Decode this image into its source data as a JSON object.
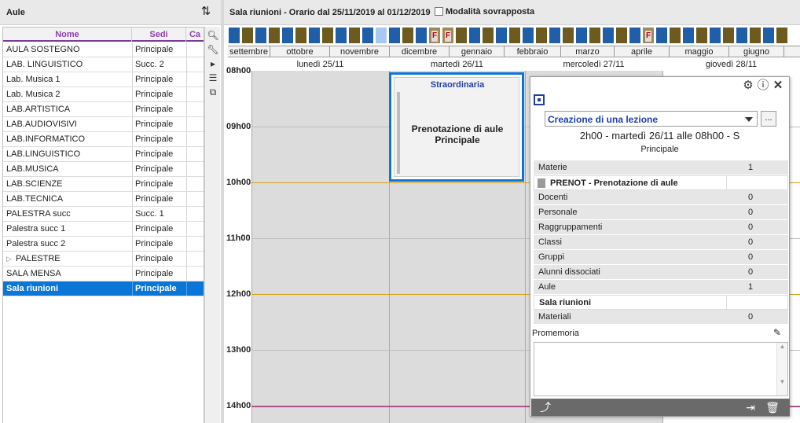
{
  "left": {
    "title": "Aule",
    "columns": [
      "Nome",
      "Sedi",
      "Ca"
    ],
    "rows": [
      {
        "name": "AULA SOSTEGNO",
        "sede": "Principale"
      },
      {
        "name": "LAB. LINGUISTICO",
        "sede": "Succ. 2"
      },
      {
        "name": "Lab. Musica 1",
        "sede": "Principale"
      },
      {
        "name": "Lab. Musica 2",
        "sede": "Principale"
      },
      {
        "name": "LAB.ARTISTICA",
        "sede": "Principale"
      },
      {
        "name": "LAB.AUDIOVISIVI",
        "sede": "Principale"
      },
      {
        "name": "LAB.INFORMATICO",
        "sede": "Principale"
      },
      {
        "name": "LAB.LINGUISTICO",
        "sede": "Principale"
      },
      {
        "name": "LAB.MUSICA",
        "sede": "Principale"
      },
      {
        "name": "LAB.SCIENZE",
        "sede": "Principale"
      },
      {
        "name": "LAB.TECNICA",
        "sede": "Principale"
      },
      {
        "name": "PALESTRA succ",
        "sede": "Succ. 1"
      },
      {
        "name": "Palestra succ 1",
        "sede": "Principale"
      },
      {
        "name": "Palestra succ 2",
        "sede": "Principale"
      },
      {
        "name": "PALESTRE",
        "sede": "Principale"
      },
      {
        "name": "SALA MENSA",
        "sede": "Principale"
      },
      {
        "name": "Sala riunioni",
        "sede": "Principale"
      }
    ]
  },
  "right": {
    "title": "Sala riunioni - Orario dal 25/11/2019 al 01/12/2019",
    "mode_label": "Modalità sovrapposta",
    "months": [
      "settembre",
      "ottobre",
      "novembre",
      "dicembre",
      "gennaio",
      "febbraio",
      "marzo",
      "aprile",
      "maggio",
      "giugno"
    ],
    "days": [
      "lunedì 25/11",
      "martedì 26/11",
      "mercoledì 27/11",
      "giovedì 28/11"
    ],
    "hours": [
      "08h00",
      "09h00",
      "10h00",
      "11h00",
      "12h00",
      "13h00",
      "14h00"
    ],
    "holiday_mark": "F"
  },
  "lesson": {
    "title": "Straordinaria",
    "text": "Prenotazione di aule Principale"
  },
  "popup": {
    "select_value": "Creazione di una lezione",
    "more": "...",
    "duration": "2h00  -  martedì 26/11 alle 08h00  -  S",
    "sede": "Principale",
    "rows": [
      {
        "label": "Materie",
        "value": "1"
      },
      {
        "label": "PRENOT - Prenotazione di aule",
        "value": ""
      },
      {
        "label": "Docenti",
        "value": "0"
      },
      {
        "label": "Personale",
        "value": "0"
      },
      {
        "label": "Raggruppamenti",
        "value": "0"
      },
      {
        "label": "Classi",
        "value": "0"
      },
      {
        "label": "Gruppi",
        "value": "0"
      },
      {
        "label": "Alunni dissociati",
        "value": "0"
      },
      {
        "label": "Aule",
        "value": "1"
      },
      {
        "label": "Sala riunioni",
        "value": ""
      },
      {
        "label": "Materiali",
        "value": "0"
      }
    ],
    "memo_label": "Promemoria"
  },
  "colors": {
    "accent": "#0a76d8",
    "brown": "#6d5a1e",
    "blue": "#1f5fa8",
    "gold": "#d4a017",
    "magenta": "#b0508a"
  }
}
